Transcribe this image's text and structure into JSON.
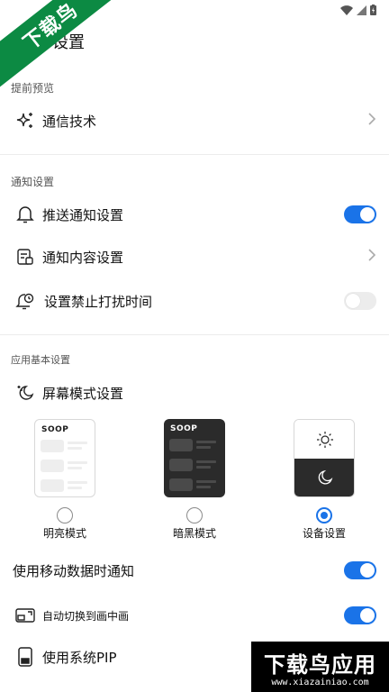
{
  "status_bar": {
    "icons": [
      "wifi-icon",
      "signal-icon",
      "battery-icon"
    ]
  },
  "watermark": {
    "top_left": "下载鸟",
    "bottom_right": "下载鸟应用",
    "url": "www.xiazainiao.com"
  },
  "header": {
    "title": "设置"
  },
  "sections": {
    "preview": {
      "label": "提前预览",
      "items": [
        {
          "label": "通信技术",
          "icon": "sparkle-icon",
          "control": "chevron"
        }
      ]
    },
    "notifications": {
      "label": "通知设置",
      "items": [
        {
          "label": "推送通知设置",
          "icon": "bell-icon",
          "control": "toggle",
          "value": "on"
        },
        {
          "label": "通知内容设置",
          "icon": "notification-content-icon",
          "control": "chevron"
        },
        {
          "label": "设置禁止打扰时间",
          "icon": "bell-clock-icon",
          "control": "toggle",
          "value": "off"
        }
      ]
    },
    "basic": {
      "label": "应用基本设置",
      "screen_mode": {
        "label": "屏幕模式设置",
        "icon": "theme-icon",
        "brand": "SOOP",
        "options": [
          {
            "label": "明亮模式",
            "selected": false
          },
          {
            "label": "暗黑模式",
            "selected": false
          },
          {
            "label": "设备设置",
            "selected": true
          }
        ]
      },
      "items": [
        {
          "label": "使用移动数据时通知",
          "control": "toggle",
          "value": "on"
        },
        {
          "label": "自动切换到画中画",
          "icon": "pip-switch-icon",
          "control": "toggle",
          "value": "on"
        },
        {
          "label": "使用系统PIP",
          "icon": "pip-icon",
          "control": "toggle",
          "value": "on"
        }
      ]
    }
  },
  "colors": {
    "accent": "#1a73e8",
    "watermark_green": "#0c8a43"
  }
}
